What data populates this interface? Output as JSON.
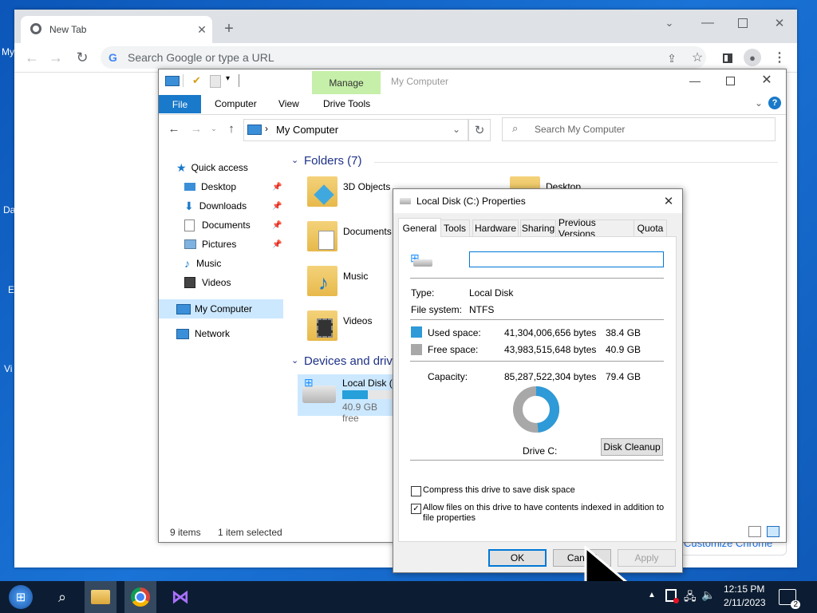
{
  "desktop": {
    "frag1": "My",
    "frag2": "Da",
    "frag3": "E",
    "frag4": "Vi"
  },
  "chrome": {
    "tab_title": "New Tab",
    "omnibox_placeholder": "Search Google or type a URL",
    "customize_label": "Customize Chrome",
    "right_frag": "n"
  },
  "explorer": {
    "title": "My Computer",
    "manage": "Manage",
    "ribbon_tabs": [
      "File",
      "Computer",
      "View",
      "Drive Tools"
    ],
    "address": "My Computer",
    "search_placeholder": "Search My Computer",
    "nav": {
      "quick_access": "Quick access",
      "items": [
        "Desktop",
        "Downloads",
        "Documents",
        "Pictures",
        "Music",
        "Videos"
      ],
      "my_computer": "My Computer",
      "network": "Network"
    },
    "folders_header": "Folders (7)",
    "folders": [
      "3D Objects",
      "Desktop",
      "Documents",
      "Music",
      "Videos"
    ],
    "devices_header": "Devices and drive",
    "drive_name": "Local Disk (",
    "drive_free": "40.9 GB free",
    "drive_used_fraction": 0.48,
    "status_items": "9 items",
    "status_selected": "1 item selected"
  },
  "dialog": {
    "title": "Local Disk (C:) Properties",
    "tabs": [
      "General",
      "Tools",
      "Hardware",
      "Sharing",
      "Previous Versions",
      "Quota"
    ],
    "name_value": "",
    "type_label": "Type:",
    "type_value": "Local Disk",
    "fs_label": "File system:",
    "fs_value": "NTFS",
    "used_label": "Used space:",
    "used_bytes": "41,304,006,656 bytes",
    "used_gb": "38.4 GB",
    "free_label": "Free space:",
    "free_bytes": "43,983,515,648 bytes",
    "free_gb": "40.9 GB",
    "cap_label": "Capacity:",
    "cap_bytes": "85,287,522,304 bytes",
    "cap_gb": "79.4 GB",
    "drive_label": "Drive C:",
    "cleanup": "Disk Cleanup",
    "compress_label": "Compress this drive to save disk space",
    "index_label_1": "Allow files on this drive to have contents indexed in addition to",
    "index_label_2": "file properties",
    "compress_checked": false,
    "index_checked": true,
    "ok": "OK",
    "cancel": "Cancel",
    "apply": "Apply",
    "used_fraction": 0.484,
    "colors": {
      "used": "#2e9ad8",
      "free": "#a8a8a8"
    }
  },
  "taskbar": {
    "time": "12:15 PM",
    "date": "2/11/2023",
    "notif_count": "2"
  }
}
